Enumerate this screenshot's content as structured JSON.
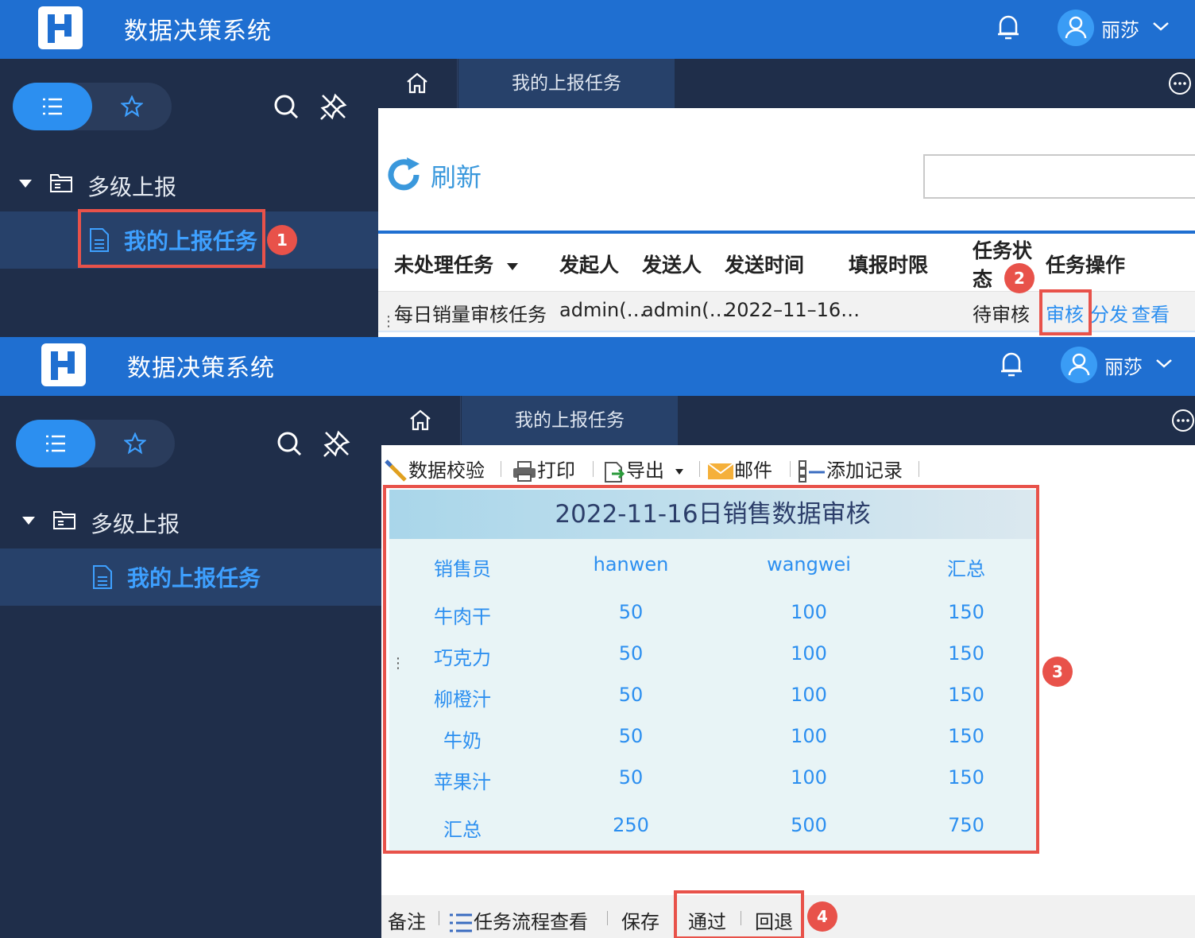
{
  "app": {
    "title": "数据决策系统",
    "user": "丽莎"
  },
  "sidebar": {
    "parent_label": "多级上报",
    "child_label": "我的上报任务"
  },
  "tabs": {
    "active_label": "我的上报任务"
  },
  "callouts": [
    "1",
    "2",
    "3",
    "4"
  ],
  "list_view": {
    "refresh_label": "刷新",
    "columns": [
      "未处理任务",
      "发起人",
      "发送人",
      "发送时间",
      "填报时限",
      "任务状态",
      "任务操作"
    ],
    "status_header_line1": "任务状",
    "status_header_line2": "态",
    "row": {
      "task": "每日销量审核任务",
      "initiator": "admin(…",
      "sender": "admin(…",
      "send_time": "2022–11–16…",
      "status": "待审核",
      "actions": [
        "审核",
        "分发",
        "查看"
      ]
    }
  },
  "toolbar": {
    "verify": "数据校验",
    "print": "打印",
    "export": "导出",
    "mail": "邮件",
    "add_record": "添加记录"
  },
  "report": {
    "title": "2022-11-16日销售数据审核",
    "header": [
      "销售员",
      "hanwen",
      "wangwei",
      "汇总"
    ],
    "rows": [
      [
        "牛肉干",
        "50",
        "100",
        "150"
      ],
      [
        "巧克力",
        "50",
        "100",
        "150"
      ],
      [
        "柳橙汁",
        "50",
        "100",
        "150"
      ],
      [
        "牛奶",
        "50",
        "100",
        "150"
      ],
      [
        "苹果汁",
        "50",
        "100",
        "150"
      ],
      [
        "汇总",
        "250",
        "500",
        "750"
      ]
    ]
  },
  "bottom_bar": {
    "note": "备注",
    "flow": "任务流程查看",
    "save": "保存",
    "approve": "通过",
    "reject": "回退"
  },
  "colors": {
    "topbar": "#1f6fd1",
    "sidebar": "#1f2e4a",
    "accent": "#2c8ff0",
    "callout": "#e8524a"
  },
  "icons": [
    "logo-icon",
    "bell-icon",
    "user-avatar-icon",
    "chevron-down-icon",
    "list-icon",
    "star-icon",
    "search-icon",
    "unpin-icon",
    "folder-icon",
    "document-icon",
    "home-icon",
    "more-icon",
    "refresh-icon",
    "printer-icon",
    "mail-icon"
  ]
}
